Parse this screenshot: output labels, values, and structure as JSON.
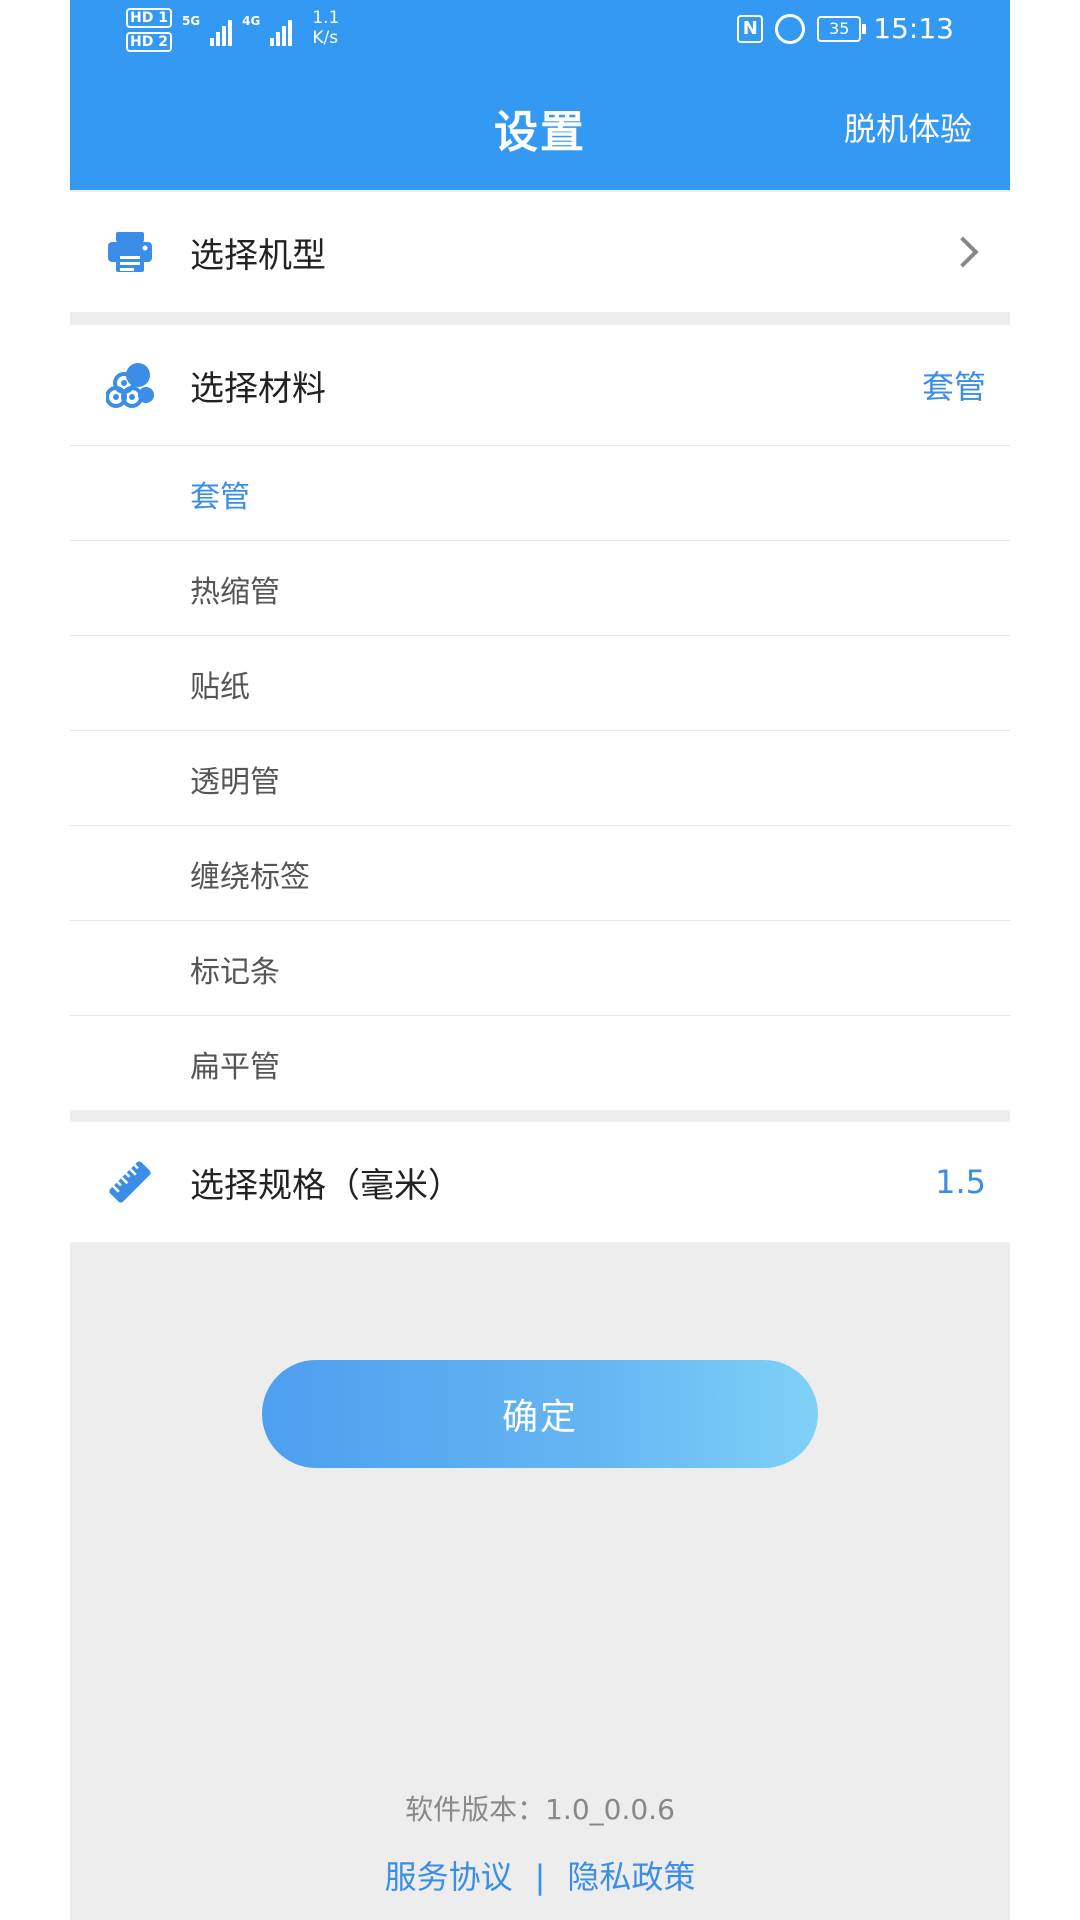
{
  "status_bar": {
    "hd1": "HD 1",
    "hd2": "HD 2",
    "net1": "5G",
    "net2": "4G",
    "speed_value": "1.1",
    "speed_unit": "K/s",
    "nfc": "N",
    "battery": "35",
    "time": "15:13"
  },
  "header": {
    "title": "设置",
    "offline_button": "脱机体验",
    "background": "#3399f3"
  },
  "model_row": {
    "label": "选择机型",
    "icon": "printer-icon"
  },
  "material_row": {
    "label": "选择材料",
    "value": "套管",
    "icon": "material-rolls-icon"
  },
  "materials": [
    {
      "label": "套管",
      "selected": true
    },
    {
      "label": "热缩管",
      "selected": false
    },
    {
      "label": "贴纸",
      "selected": false
    },
    {
      "label": "透明管",
      "selected": false
    },
    {
      "label": "缠绕标签",
      "selected": false
    },
    {
      "label": "标记条",
      "selected": false
    },
    {
      "label": "扁平管",
      "selected": false
    }
  ],
  "spec_row": {
    "label": "选择规格（毫米）",
    "value": "1.5",
    "icon": "ruler-icon"
  },
  "confirm_button": "确定",
  "footer": {
    "version": "软件版本：1.0_0.0.6",
    "service_link": "服务协议",
    "separator": "|",
    "privacy_link": "隐私政策"
  },
  "colors": {
    "accent": "#3a8ee8",
    "page_bg": "#ededed"
  }
}
